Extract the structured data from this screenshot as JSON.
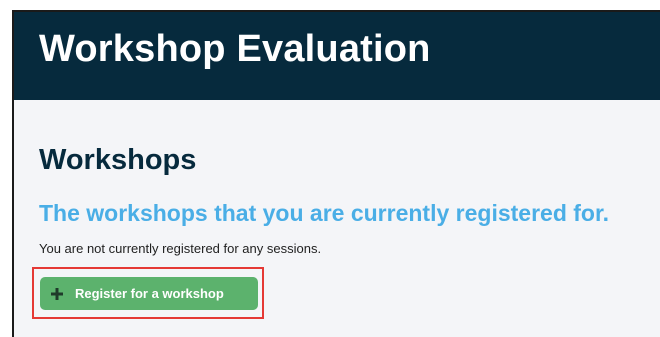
{
  "header": {
    "title": "Workshop Evaluation"
  },
  "main": {
    "section_title": "Workshops",
    "subheading": "The workshops that you are currently registered for.",
    "notice": "You are not currently registered for any sessions.",
    "register_button": {
      "label": "Register for a workshop",
      "icon": "plus-icon",
      "color": "#5cb26d"
    }
  },
  "colors": {
    "header_bg": "#062a3d",
    "page_bg": "#f4f5f8",
    "accent_blue": "#4aaee6",
    "highlight_red": "#e53935"
  }
}
